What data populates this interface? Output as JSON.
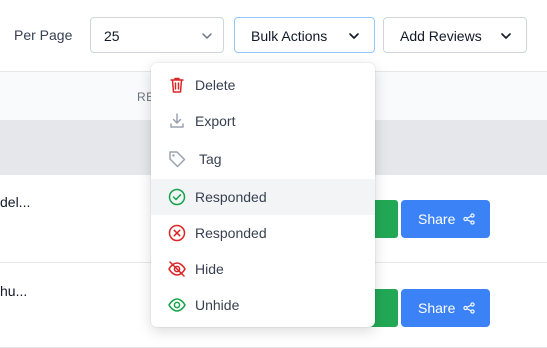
{
  "toolbar": {
    "per_page_label": "Per Page",
    "per_page_value": "25",
    "bulk_actions_label": "Bulk Actions",
    "add_reviews_label": "Add Reviews"
  },
  "table": {
    "partial_header": "RE",
    "rows": [
      {
        "snippet": "del...",
        "share_label": "Share"
      },
      {
        "snippet": "hu...",
        "share_label": "Share"
      }
    ]
  },
  "bulk_menu": {
    "items": [
      {
        "label": "Delete",
        "icon": "trash-icon",
        "color": "#dc2626"
      },
      {
        "label": "Export",
        "icon": "download-icon",
        "color": "#9ca3af"
      },
      {
        "label": "Tag",
        "icon": "tag-icon",
        "color": "#9ca3af"
      },
      {
        "label": "Responded",
        "icon": "check-circle-icon",
        "color": "#16a34a",
        "highlighted": true
      },
      {
        "label": "Responded",
        "icon": "x-circle-icon",
        "color": "#dc2626"
      },
      {
        "label": "Hide",
        "icon": "eye-off-icon",
        "color": "#dc2626"
      },
      {
        "label": "Unhide",
        "icon": "eye-icon",
        "color": "#16a34a"
      }
    ]
  },
  "colors": {
    "primary": "#3b82f6",
    "success": "#22a855",
    "danger": "#dc2626"
  }
}
